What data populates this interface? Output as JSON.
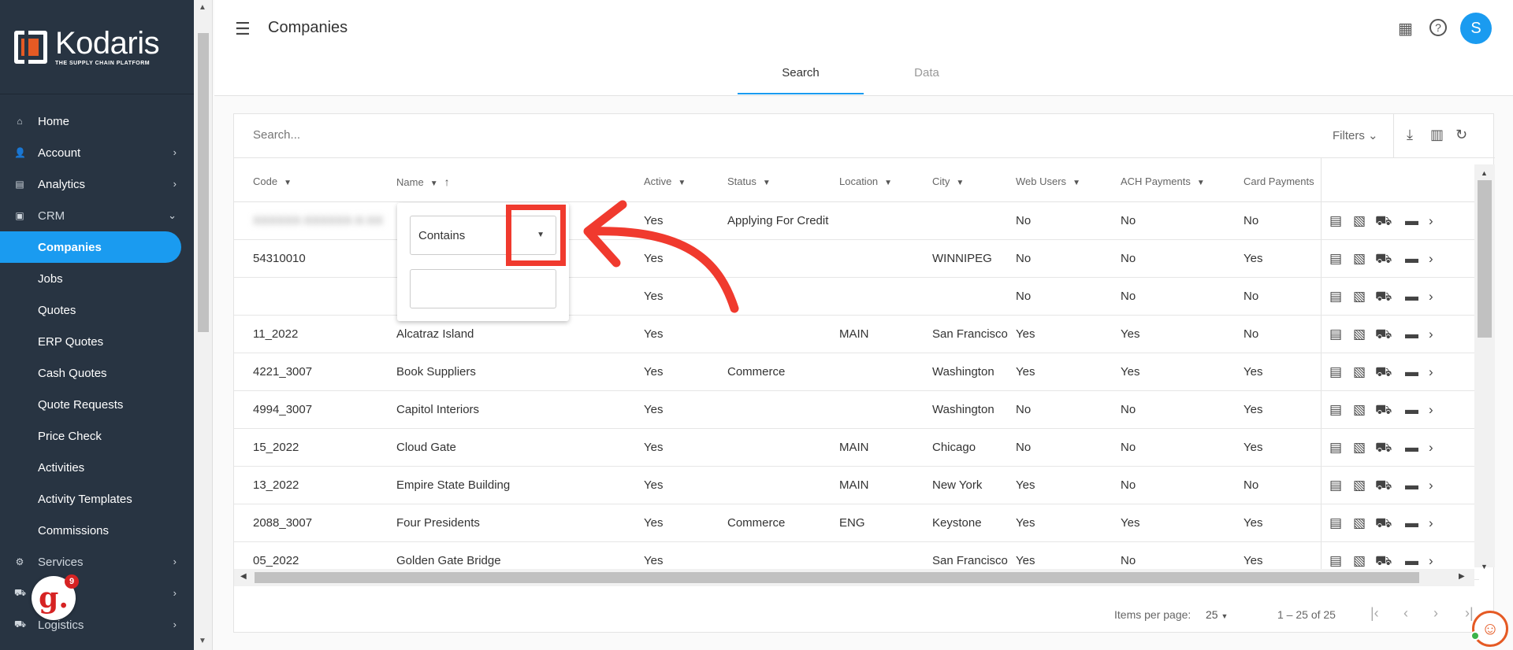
{
  "brand": {
    "name": "Kodaris",
    "tagline": "THE SUPPLY CHAIN PLATFORM",
    "accent": "#1a9bf0",
    "logo_color": "#e55a24"
  },
  "sidebar": {
    "items": [
      {
        "label": "Home",
        "icon": "home-icon"
      },
      {
        "label": "Account",
        "icon": "person-icon"
      },
      {
        "label": "Analytics",
        "icon": "chart-icon"
      },
      {
        "label": "CRM",
        "icon": "contacts-icon"
      },
      {
        "label": "Companies"
      },
      {
        "label": "Jobs"
      },
      {
        "label": "Quotes"
      },
      {
        "label": "ERP Quotes"
      },
      {
        "label": "Cash Quotes"
      },
      {
        "label": "Quote Requests"
      },
      {
        "label": "Price Check"
      },
      {
        "label": "Activities"
      },
      {
        "label": "Activity Templates"
      },
      {
        "label": "Commissions"
      },
      {
        "label": "Services",
        "icon": "gears-icon"
      },
      {
        "label": "",
        "icon": "truck-icon"
      },
      {
        "label": "Logistics",
        "icon": "delivery-icon"
      }
    ],
    "badge": {
      "letter": "g.",
      "count": "9"
    }
  },
  "header": {
    "title": "Companies",
    "avatar_initial": "S"
  },
  "tabs": [
    {
      "label": "Search"
    },
    {
      "label": "Data"
    }
  ],
  "search": {
    "placeholder": "Search...",
    "filters_label": "Filters"
  },
  "table": {
    "columns": [
      "Code",
      "Name",
      "Active",
      "Status",
      "Location",
      "City",
      "Web Users",
      "ACH Payments",
      "Card Payments"
    ],
    "rows": [
      {
        "code": "XXXXXX-XXXXXX-X-XX",
        "name": "",
        "active": "Yes",
        "status": "Applying For Credit",
        "location": "",
        "city": "",
        "web_users": "No",
        "ach": "No",
        "card": "No"
      },
      {
        "code": "54310010",
        "name": "",
        "active": "Yes",
        "status": "",
        "location": "",
        "city": "WINNIPEG",
        "web_users": "No",
        "ach": "No",
        "card": "Yes"
      },
      {
        "code": "",
        "name": "",
        "active": "Yes",
        "status": "",
        "location": "",
        "city": "",
        "web_users": "No",
        "ach": "No",
        "card": "No"
      },
      {
        "code": "11_2022",
        "name": "Alcatraz Island",
        "active": "Yes",
        "status": "",
        "location": "MAIN",
        "city": "San Francisco",
        "web_users": "Yes",
        "ach": "Yes",
        "card": "No"
      },
      {
        "code": "4221_3007",
        "name": "Book Suppliers",
        "active": "Yes",
        "status": "Commerce",
        "location": "",
        "city": "Washington",
        "web_users": "Yes",
        "ach": "Yes",
        "card": "Yes"
      },
      {
        "code": "4994_3007",
        "name": "Capitol Interiors",
        "active": "Yes",
        "status": "",
        "location": "",
        "city": "Washington",
        "web_users": "No",
        "ach": "No",
        "card": "Yes"
      },
      {
        "code": "15_2022",
        "name": "Cloud Gate",
        "active": "Yes",
        "status": "",
        "location": "MAIN",
        "city": "Chicago",
        "web_users": "No",
        "ach": "No",
        "card": "Yes"
      },
      {
        "code": "13_2022",
        "name": "Empire State Building",
        "active": "Yes",
        "status": "",
        "location": "MAIN",
        "city": "New York",
        "web_users": "Yes",
        "ach": "No",
        "card": "No"
      },
      {
        "code": "2088_3007",
        "name": "Four Presidents",
        "active": "Yes",
        "status": "Commerce",
        "location": "ENG",
        "city": "Keystone",
        "web_users": "Yes",
        "ach": "Yes",
        "card": "Yes"
      },
      {
        "code": "05_2022",
        "name": "Golden Gate Bridge",
        "active": "Yes",
        "status": "",
        "location": "",
        "city": "San Francisco",
        "web_users": "Yes",
        "ach": "No",
        "card": "Yes"
      }
    ]
  },
  "filter_popup": {
    "mode": "Contains",
    "value": ""
  },
  "paginator": {
    "items_per_page_label": "Items per page:",
    "items_per_page": "25",
    "range": "1 – 25 of 25"
  },
  "annotation": {
    "color": "#f03a2e"
  }
}
